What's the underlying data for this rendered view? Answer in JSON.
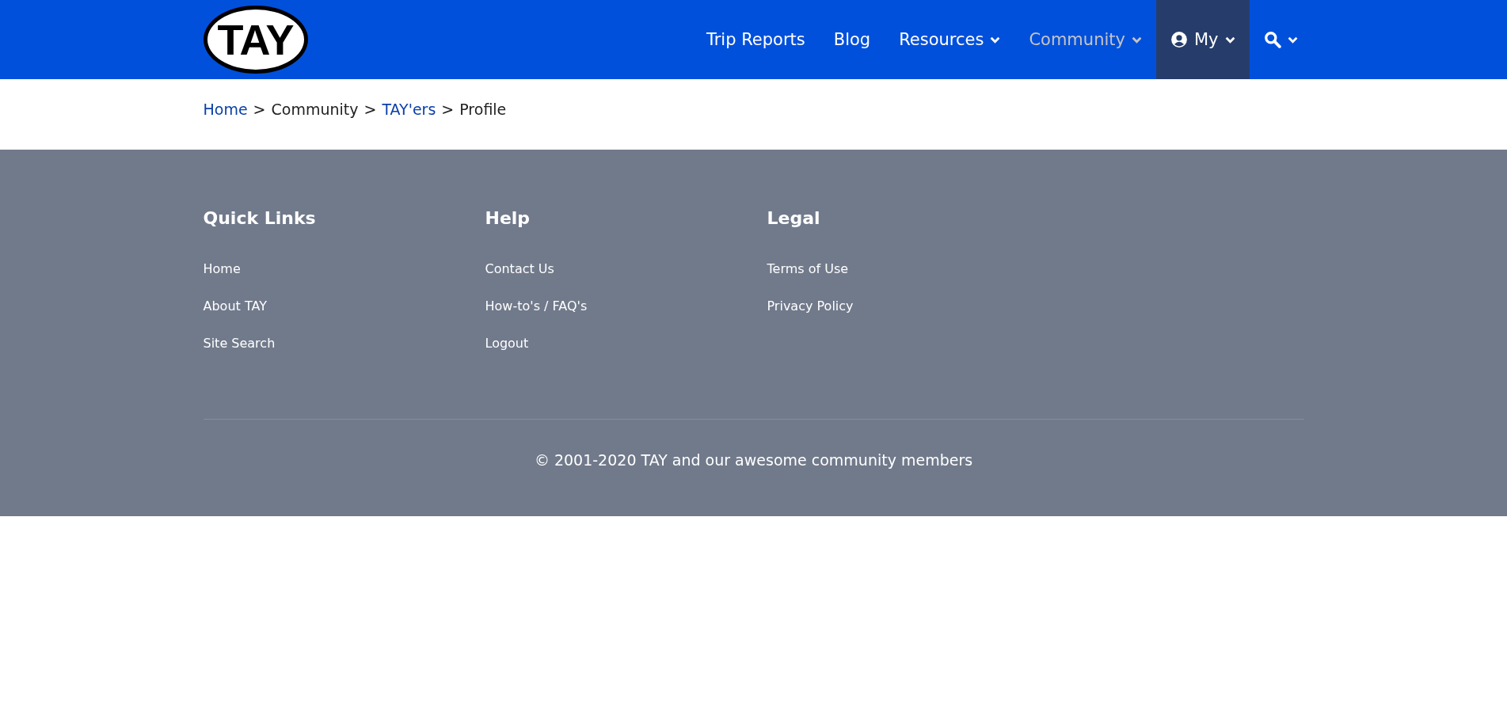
{
  "header": {
    "logo": "TAY",
    "nav": [
      {
        "kind": "text",
        "label": "Trip Reports",
        "dropdown": false,
        "selected": false,
        "highlighted": false
      },
      {
        "kind": "text",
        "label": "Blog",
        "dropdown": false,
        "selected": false,
        "highlighted": false
      },
      {
        "kind": "text",
        "label": "Resources",
        "dropdown": true,
        "selected": false,
        "highlighted": false
      },
      {
        "kind": "text",
        "label": "Community",
        "dropdown": true,
        "selected": true,
        "highlighted": false
      },
      {
        "kind": "user",
        "label": "My",
        "dropdown": true,
        "selected": false,
        "highlighted": true
      },
      {
        "kind": "search",
        "dropdown": true,
        "selected": false,
        "highlighted": false
      }
    ]
  },
  "breadcrumb": [
    {
      "label": "Home",
      "link": true
    },
    {
      "separator": ">",
      "label": "Community",
      "link": false
    },
    {
      "separator": ">",
      "label": "TAY'ers",
      "link": true
    },
    {
      "separator": ">",
      "label": "Profile",
      "link": false
    }
  ],
  "footer": {
    "columns": [
      {
        "title": "Quick Links",
        "links": [
          "Home",
          "About TAY",
          "Site Search"
        ]
      },
      {
        "title": "Help",
        "links": [
          "Contact Us",
          "How-to's / FAQ's",
          "Logout"
        ]
      },
      {
        "title": "Legal",
        "links": [
          "Terms of Use",
          "Privacy Policy"
        ]
      }
    ],
    "copyright": "© 2001-2020 TAY and our awesome community members"
  }
}
